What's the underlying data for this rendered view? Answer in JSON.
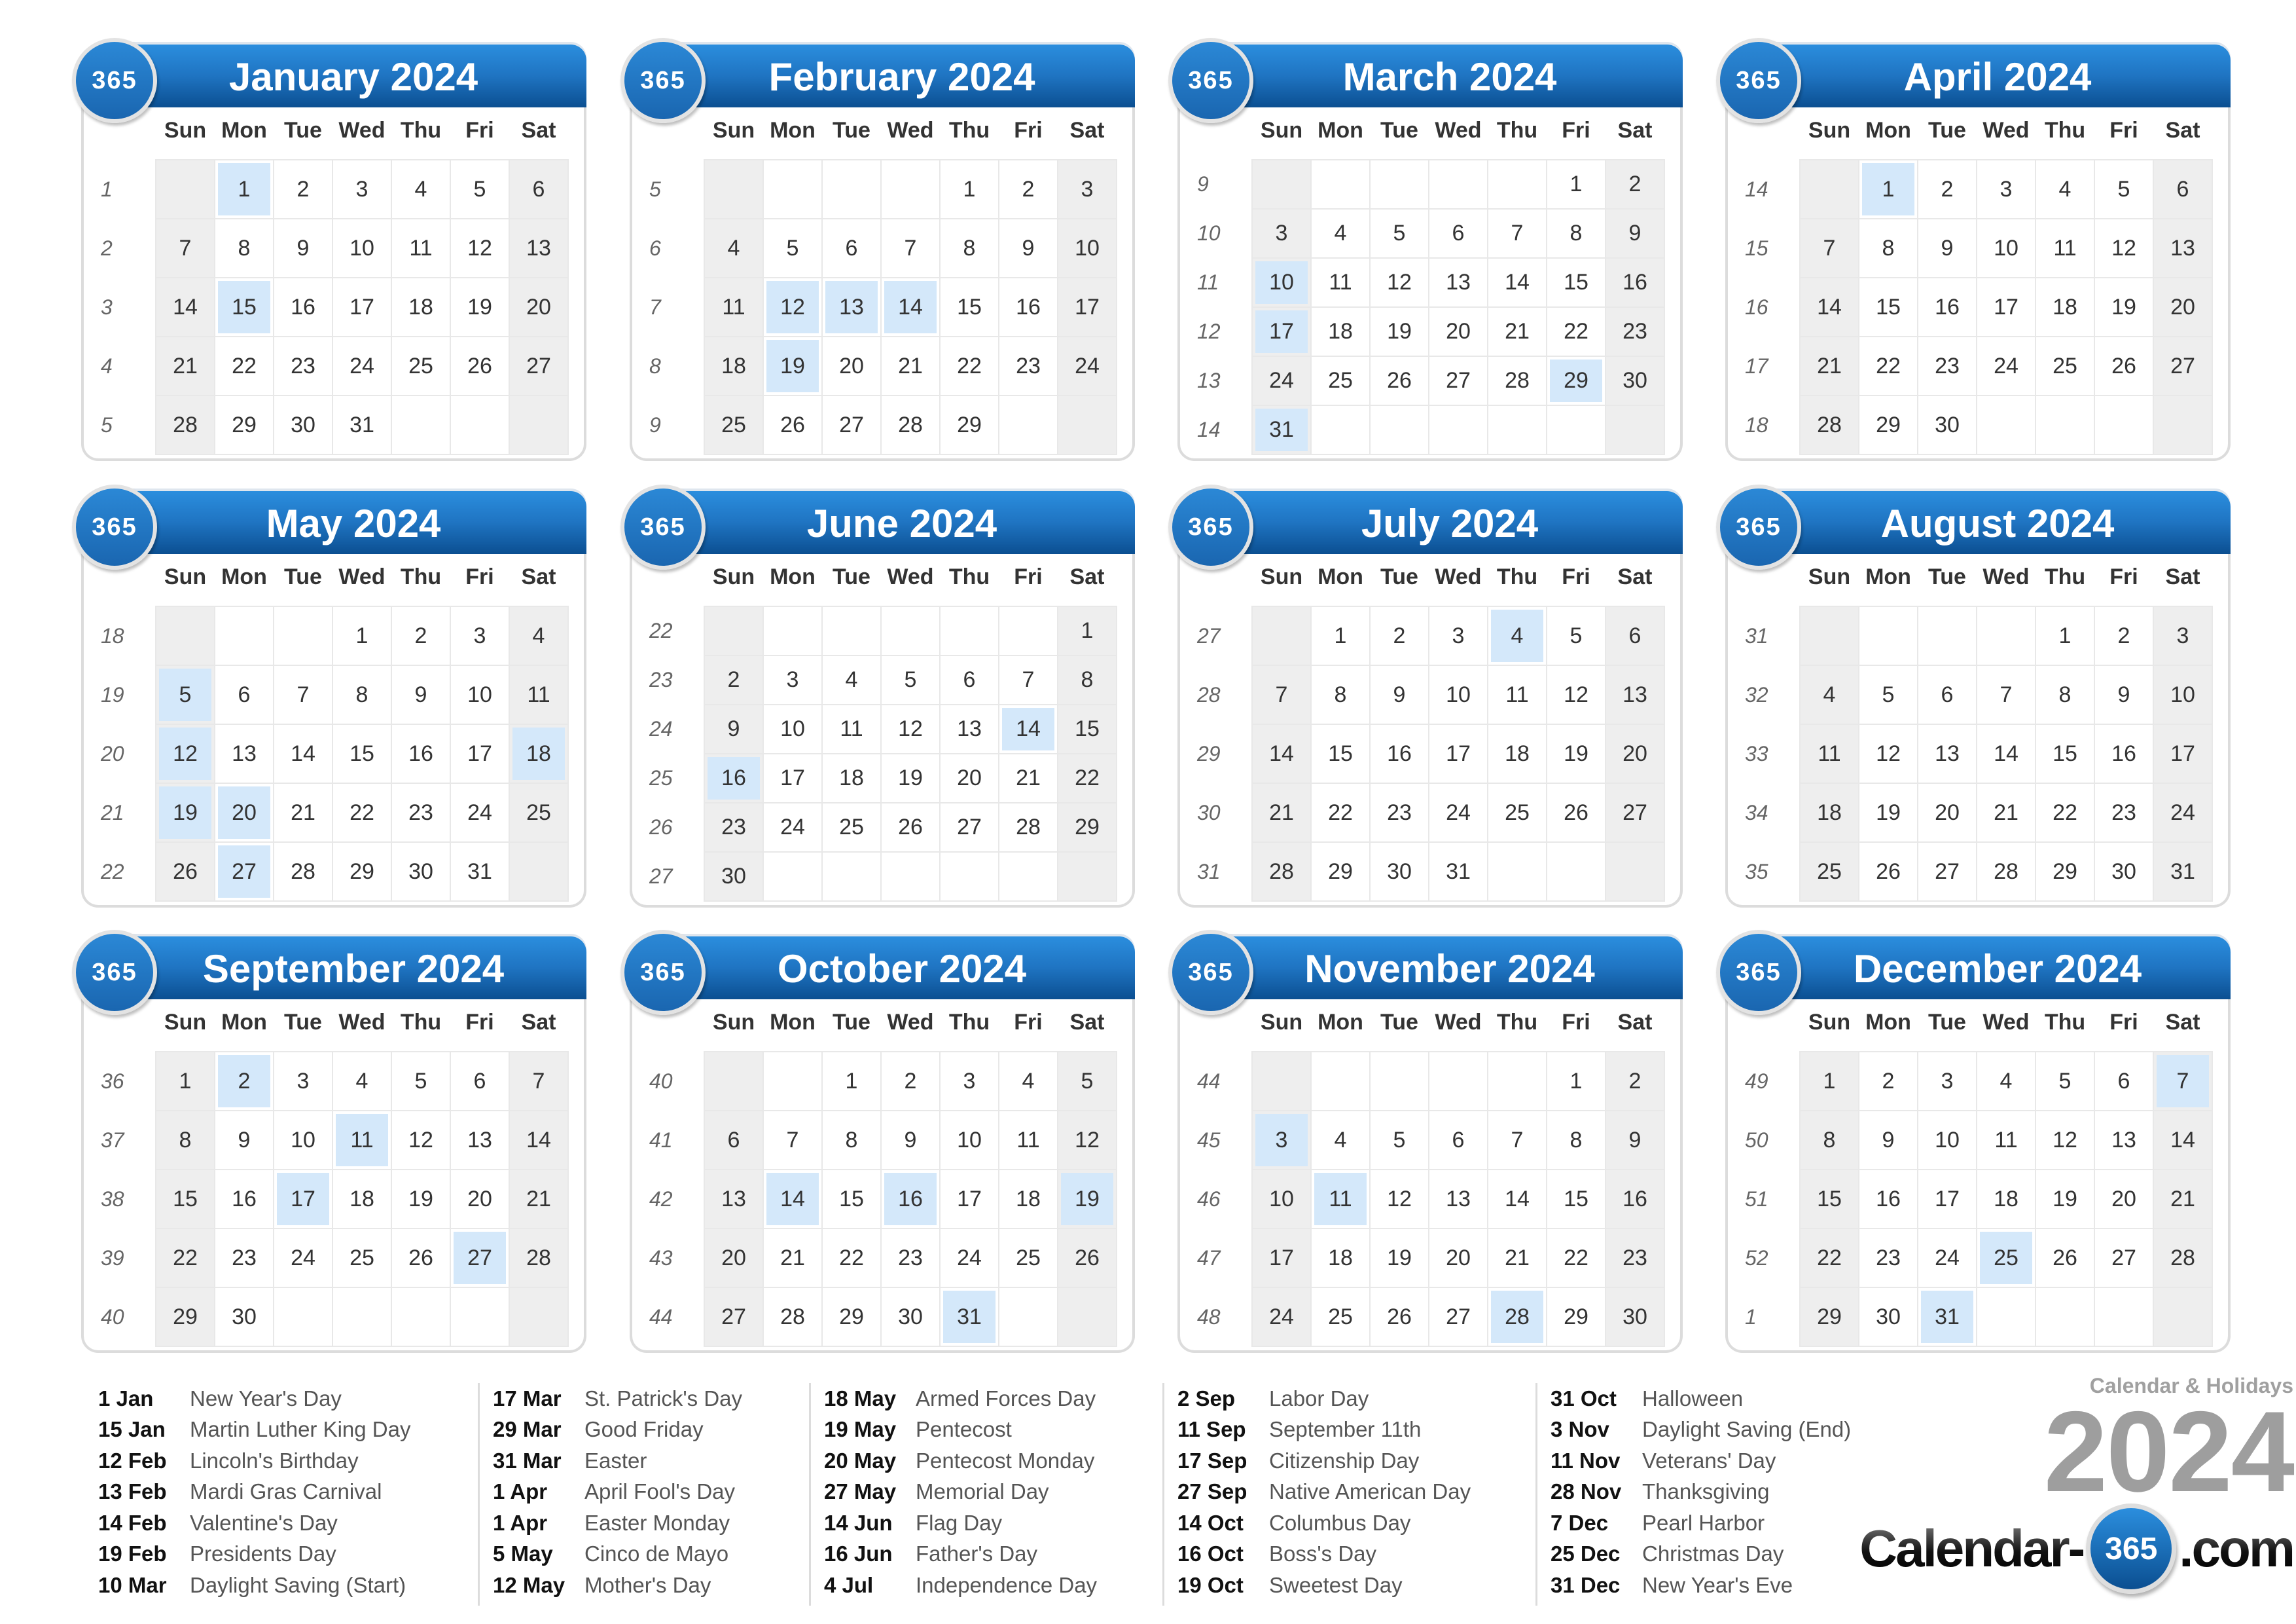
{
  "weekday_headers": [
    "Sun",
    "Mon",
    "Tue",
    "Wed",
    "Thu",
    "Fri",
    "Sat"
  ],
  "badge_label": "365",
  "months": [
    {
      "title": "January 2024",
      "weeks": [
        {
          "wk": "1",
          "days": [
            "",
            "1",
            "2",
            "3",
            "4",
            "5",
            "6"
          ]
        },
        {
          "wk": "2",
          "days": [
            "7",
            "8",
            "9",
            "10",
            "11",
            "12",
            "13"
          ]
        },
        {
          "wk": "3",
          "days": [
            "14",
            "15",
            "16",
            "17",
            "18",
            "19",
            "20"
          ]
        },
        {
          "wk": "4",
          "days": [
            "21",
            "22",
            "23",
            "24",
            "25",
            "26",
            "27"
          ]
        },
        {
          "wk": "5",
          "days": [
            "28",
            "29",
            "30",
            "31",
            "",
            "",
            ""
          ]
        }
      ],
      "highlighted": [
        "1",
        "15"
      ]
    },
    {
      "title": "February 2024",
      "weeks": [
        {
          "wk": "5",
          "days": [
            "",
            "",
            "",
            "",
            "1",
            "2",
            "3"
          ]
        },
        {
          "wk": "6",
          "days": [
            "4",
            "5",
            "6",
            "7",
            "8",
            "9",
            "10"
          ]
        },
        {
          "wk": "7",
          "days": [
            "11",
            "12",
            "13",
            "14",
            "15",
            "16",
            "17"
          ]
        },
        {
          "wk": "8",
          "days": [
            "18",
            "19",
            "20",
            "21",
            "22",
            "23",
            "24"
          ]
        },
        {
          "wk": "9",
          "days": [
            "25",
            "26",
            "27",
            "28",
            "29",
            "",
            ""
          ]
        }
      ],
      "highlighted": [
        "12",
        "13",
        "14",
        "19"
      ]
    },
    {
      "title": "March 2024",
      "weeks": [
        {
          "wk": "9",
          "days": [
            "",
            "",
            "",
            "",
            "",
            "1",
            "2"
          ]
        },
        {
          "wk": "10",
          "days": [
            "3",
            "4",
            "5",
            "6",
            "7",
            "8",
            "9"
          ]
        },
        {
          "wk": "11",
          "days": [
            "10",
            "11",
            "12",
            "13",
            "14",
            "15",
            "16"
          ]
        },
        {
          "wk": "12",
          "days": [
            "17",
            "18",
            "19",
            "20",
            "21",
            "22",
            "23"
          ]
        },
        {
          "wk": "13",
          "days": [
            "24",
            "25",
            "26",
            "27",
            "28",
            "29",
            "30"
          ]
        },
        {
          "wk": "14",
          "days": [
            "31",
            "",
            "",
            "",
            "",
            "",
            ""
          ]
        }
      ],
      "highlighted": [
        "10",
        "17",
        "29",
        "31"
      ]
    },
    {
      "title": "April 2024",
      "weeks": [
        {
          "wk": "14",
          "days": [
            "",
            "1",
            "2",
            "3",
            "4",
            "5",
            "6"
          ]
        },
        {
          "wk": "15",
          "days": [
            "7",
            "8",
            "9",
            "10",
            "11",
            "12",
            "13"
          ]
        },
        {
          "wk": "16",
          "days": [
            "14",
            "15",
            "16",
            "17",
            "18",
            "19",
            "20"
          ]
        },
        {
          "wk": "17",
          "days": [
            "21",
            "22",
            "23",
            "24",
            "25",
            "26",
            "27"
          ]
        },
        {
          "wk": "18",
          "days": [
            "28",
            "29",
            "30",
            "",
            "",
            "",
            ""
          ]
        }
      ],
      "highlighted": [
        "1"
      ]
    },
    {
      "title": "May 2024",
      "weeks": [
        {
          "wk": "18",
          "days": [
            "",
            "",
            "",
            "1",
            "2",
            "3",
            "4"
          ]
        },
        {
          "wk": "19",
          "days": [
            "5",
            "6",
            "7",
            "8",
            "9",
            "10",
            "11"
          ]
        },
        {
          "wk": "20",
          "days": [
            "12",
            "13",
            "14",
            "15",
            "16",
            "17",
            "18"
          ]
        },
        {
          "wk": "21",
          "days": [
            "19",
            "20",
            "21",
            "22",
            "23",
            "24",
            "25"
          ]
        },
        {
          "wk": "22",
          "days": [
            "26",
            "27",
            "28",
            "29",
            "30",
            "31",
            ""
          ]
        }
      ],
      "highlighted": [
        "5",
        "12",
        "18",
        "19",
        "20",
        "27"
      ]
    },
    {
      "title": "June 2024",
      "weeks": [
        {
          "wk": "22",
          "days": [
            "",
            "",
            "",
            "",
            "",
            "",
            "1"
          ]
        },
        {
          "wk": "23",
          "days": [
            "2",
            "3",
            "4",
            "5",
            "6",
            "7",
            "8"
          ]
        },
        {
          "wk": "24",
          "days": [
            "9",
            "10",
            "11",
            "12",
            "13",
            "14",
            "15"
          ]
        },
        {
          "wk": "25",
          "days": [
            "16",
            "17",
            "18",
            "19",
            "20",
            "21",
            "22"
          ]
        },
        {
          "wk": "26",
          "days": [
            "23",
            "24",
            "25",
            "26",
            "27",
            "28",
            "29"
          ]
        },
        {
          "wk": "27",
          "days": [
            "30",
            "",
            "",
            "",
            "",
            "",
            ""
          ]
        }
      ],
      "highlighted": [
        "14",
        "16"
      ]
    },
    {
      "title": "July 2024",
      "weeks": [
        {
          "wk": "27",
          "days": [
            "",
            "1",
            "2",
            "3",
            "4",
            "5",
            "6"
          ]
        },
        {
          "wk": "28",
          "days": [
            "7",
            "8",
            "9",
            "10",
            "11",
            "12",
            "13"
          ]
        },
        {
          "wk": "29",
          "days": [
            "14",
            "15",
            "16",
            "17",
            "18",
            "19",
            "20"
          ]
        },
        {
          "wk": "30",
          "days": [
            "21",
            "22",
            "23",
            "24",
            "25",
            "26",
            "27"
          ]
        },
        {
          "wk": "31",
          "days": [
            "28",
            "29",
            "30",
            "31",
            "",
            "",
            ""
          ]
        }
      ],
      "highlighted": [
        "4"
      ]
    },
    {
      "title": "August 2024",
      "weeks": [
        {
          "wk": "31",
          "days": [
            "",
            "",
            "",
            "",
            "1",
            "2",
            "3"
          ]
        },
        {
          "wk": "32",
          "days": [
            "4",
            "5",
            "6",
            "7",
            "8",
            "9",
            "10"
          ]
        },
        {
          "wk": "33",
          "days": [
            "11",
            "12",
            "13",
            "14",
            "15",
            "16",
            "17"
          ]
        },
        {
          "wk": "34",
          "days": [
            "18",
            "19",
            "20",
            "21",
            "22",
            "23",
            "24"
          ]
        },
        {
          "wk": "35",
          "days": [
            "25",
            "26",
            "27",
            "28",
            "29",
            "30",
            "31"
          ]
        }
      ],
      "highlighted": []
    },
    {
      "title": "September 2024",
      "weeks": [
        {
          "wk": "36",
          "days": [
            "1",
            "2",
            "3",
            "4",
            "5",
            "6",
            "7"
          ]
        },
        {
          "wk": "37",
          "days": [
            "8",
            "9",
            "10",
            "11",
            "12",
            "13",
            "14"
          ]
        },
        {
          "wk": "38",
          "days": [
            "15",
            "16",
            "17",
            "18",
            "19",
            "20",
            "21"
          ]
        },
        {
          "wk": "39",
          "days": [
            "22",
            "23",
            "24",
            "25",
            "26",
            "27",
            "28"
          ]
        },
        {
          "wk": "40",
          "days": [
            "29",
            "30",
            "",
            "",
            "",
            "",
            ""
          ]
        }
      ],
      "highlighted": [
        "2",
        "11",
        "17",
        "27"
      ]
    },
    {
      "title": "October 2024",
      "weeks": [
        {
          "wk": "40",
          "days": [
            "",
            "",
            "1",
            "2",
            "3",
            "4",
            "5"
          ]
        },
        {
          "wk": "41",
          "days": [
            "6",
            "7",
            "8",
            "9",
            "10",
            "11",
            "12"
          ]
        },
        {
          "wk": "42",
          "days": [
            "13",
            "14",
            "15",
            "16",
            "17",
            "18",
            "19"
          ]
        },
        {
          "wk": "43",
          "days": [
            "20",
            "21",
            "22",
            "23",
            "24",
            "25",
            "26"
          ]
        },
        {
          "wk": "44",
          "days": [
            "27",
            "28",
            "29",
            "30",
            "31",
            "",
            ""
          ]
        }
      ],
      "highlighted": [
        "14",
        "16",
        "19",
        "31"
      ]
    },
    {
      "title": "November 2024",
      "weeks": [
        {
          "wk": "44",
          "days": [
            "",
            "",
            "",
            "",
            "",
            "1",
            "2"
          ]
        },
        {
          "wk": "45",
          "days": [
            "3",
            "4",
            "5",
            "6",
            "7",
            "8",
            "9"
          ]
        },
        {
          "wk": "46",
          "days": [
            "10",
            "11",
            "12",
            "13",
            "14",
            "15",
            "16"
          ]
        },
        {
          "wk": "47",
          "days": [
            "17",
            "18",
            "19",
            "20",
            "21",
            "22",
            "23"
          ]
        },
        {
          "wk": "48",
          "days": [
            "24",
            "25",
            "26",
            "27",
            "28",
            "29",
            "30"
          ]
        }
      ],
      "highlighted": [
        "3",
        "11",
        "28"
      ]
    },
    {
      "title": "December 2024",
      "weeks": [
        {
          "wk": "49",
          "days": [
            "1",
            "2",
            "3",
            "4",
            "5",
            "6",
            "7"
          ]
        },
        {
          "wk": "50",
          "days": [
            "8",
            "9",
            "10",
            "11",
            "12",
            "13",
            "14"
          ]
        },
        {
          "wk": "51",
          "days": [
            "15",
            "16",
            "17",
            "18",
            "19",
            "20",
            "21"
          ]
        },
        {
          "wk": "52",
          "days": [
            "22",
            "23",
            "24",
            "25",
            "26",
            "27",
            "28"
          ]
        },
        {
          "wk": "1",
          "days": [
            "29",
            "30",
            "31",
            "",
            "",
            "",
            ""
          ]
        }
      ],
      "highlighted": [
        "7",
        "25",
        "31"
      ]
    }
  ],
  "holiday_columns": [
    [
      {
        "date": "1 Jan",
        "name": "New Year's Day"
      },
      {
        "date": "15 Jan",
        "name": "Martin Luther King Day"
      },
      {
        "date": "12 Feb",
        "name": "Lincoln's Birthday"
      },
      {
        "date": "13 Feb",
        "name": "Mardi Gras Carnival"
      },
      {
        "date": "14 Feb",
        "name": "Valentine's Day"
      },
      {
        "date": "19 Feb",
        "name": "Presidents Day"
      },
      {
        "date": "10 Mar",
        "name": "Daylight Saving (Start)"
      }
    ],
    [
      {
        "date": "17 Mar",
        "name": "St. Patrick's Day"
      },
      {
        "date": "29 Mar",
        "name": "Good Friday"
      },
      {
        "date": "31 Mar",
        "name": "Easter"
      },
      {
        "date": "1 Apr",
        "name": "April Fool's Day"
      },
      {
        "date": "1 Apr",
        "name": "Easter Monday"
      },
      {
        "date": "5 May",
        "name": "Cinco de Mayo"
      },
      {
        "date": "12 May",
        "name": "Mother's Day"
      }
    ],
    [
      {
        "date": "18 May",
        "name": "Armed Forces Day"
      },
      {
        "date": "19 May",
        "name": "Pentecost"
      },
      {
        "date": "20 May",
        "name": "Pentecost Monday"
      },
      {
        "date": "27 May",
        "name": "Memorial Day"
      },
      {
        "date": "14 Jun",
        "name": "Flag Day"
      },
      {
        "date": "16 Jun",
        "name": "Father's Day"
      },
      {
        "date": "4 Jul",
        "name": "Independence Day"
      }
    ],
    [
      {
        "date": "2 Sep",
        "name": "Labor Day"
      },
      {
        "date": "11 Sep",
        "name": "September 11th"
      },
      {
        "date": "17 Sep",
        "name": "Citizenship Day"
      },
      {
        "date": "27 Sep",
        "name": "Native American Day"
      },
      {
        "date": "14 Oct",
        "name": "Columbus Day"
      },
      {
        "date": "16 Oct",
        "name": "Boss's Day"
      },
      {
        "date": "19 Oct",
        "name": "Sweetest Day"
      }
    ],
    [
      {
        "date": "31 Oct",
        "name": "Halloween"
      },
      {
        "date": "3 Nov",
        "name": "Daylight Saving (End)"
      },
      {
        "date": "11 Nov",
        "name": "Veterans' Day"
      },
      {
        "date": "28 Nov",
        "name": "Thanksgiving"
      },
      {
        "date": "7 Dec",
        "name": "Pearl Harbor"
      },
      {
        "date": "25 Dec",
        "name": "Christmas Day"
      },
      {
        "date": "31 Dec",
        "name": "New Year's Eve"
      }
    ]
  ],
  "branding": {
    "subtitle": "Calendar & Holidays",
    "year": "2024",
    "logo_prefix": "Calendar-",
    "logo_badge": "365",
    "logo_suffix": ".com"
  },
  "colors": {
    "banner_top": "#2b8ede",
    "banner_bottom": "#0b4f91",
    "holiday_cell": "#d4e8fa",
    "weekend_cell": "#eeeeee",
    "brand_gray": "#9e9e9e"
  }
}
